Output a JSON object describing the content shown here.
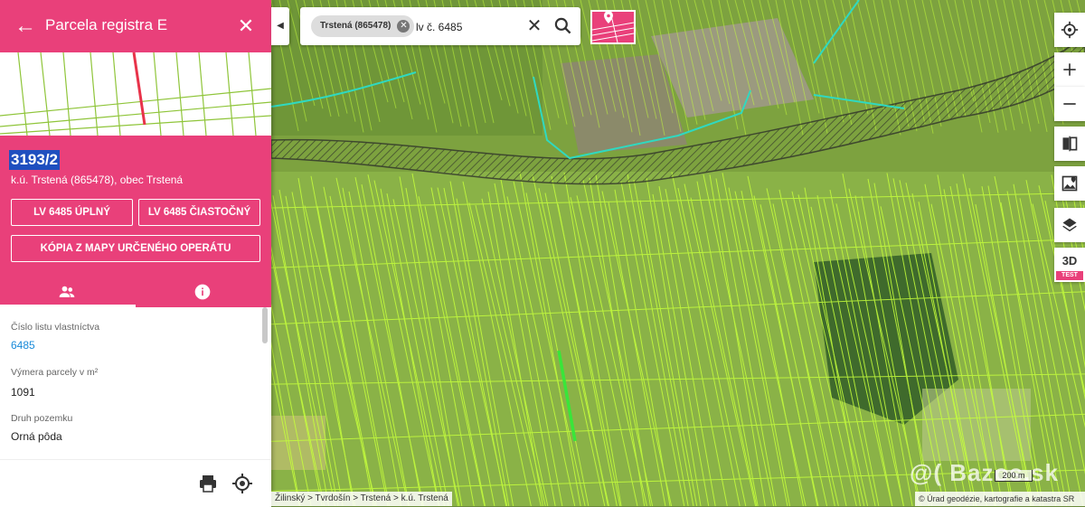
{
  "panel": {
    "title": "Parcela registra E",
    "parcel_number": "3193/2",
    "cadastral_info": "k.ú. Trstená (865478), obec Trstená",
    "buttons": {
      "lv_full": "LV 6485 ÚPLNÝ",
      "lv_partial": "LV 6485 ČIASTOČNÝ",
      "map_copy": "KÓPIA Z MAPY URČENÉHO OPERÁTU"
    },
    "tabs": [
      "owners-icon",
      "info-icon"
    ],
    "fields": [
      {
        "label": "Číslo listu vlastníctva",
        "value": "6485"
      },
      {
        "label": "Výmera parcely v m²",
        "value": "1091"
      },
      {
        "label": "Druh pozemku",
        "value": "Orná pôda"
      }
    ]
  },
  "search": {
    "chip_label": "Trstená (865478)",
    "query": "lv č. 6485"
  },
  "map_controls": {
    "three_d": "3D",
    "test_badge": "TEST"
  },
  "map": {
    "breadcrumb": "Žilinský > Tvrdošín > Trstená > k.ú. Trstená",
    "attribution": "© Úrad geodézie, kartografie a katastra SR",
    "scale": "200 m",
    "watermark": "@( Bazos.sk"
  },
  "colors": {
    "accent": "#e9407a",
    "parcel_highlight": "#39e639",
    "boundary": "#2fd9c0"
  }
}
